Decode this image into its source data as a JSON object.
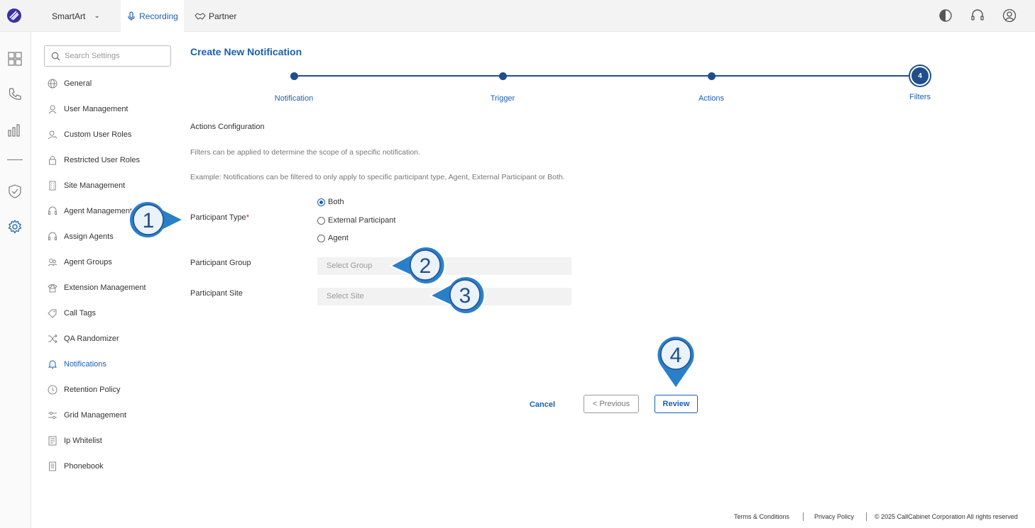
{
  "topbar": {
    "product": "SmartArt",
    "tabs": [
      {
        "label": "Recording",
        "active": true
      },
      {
        "label": "Partner",
        "active": false
      }
    ],
    "accent_color": "#1a5fb4"
  },
  "search": {
    "placeholder": "Search Settings",
    "value": ""
  },
  "sidebar": {
    "items": [
      {
        "label": "General",
        "icon": "globe-icon"
      },
      {
        "label": "User Management",
        "icon": "users-icon"
      },
      {
        "label": "Custom User Roles",
        "icon": "user-key-icon"
      },
      {
        "label": "Restricted User Roles",
        "icon": "lock-icon"
      },
      {
        "label": "Site Management",
        "icon": "building-icon"
      },
      {
        "label": "Agent Management",
        "icon": "headset-icon"
      },
      {
        "label": "Assign Agents",
        "icon": "headset-icon"
      },
      {
        "label": "Agent Groups",
        "icon": "group-icon"
      },
      {
        "label": "Extension Management",
        "icon": "phone-icon"
      },
      {
        "label": "Call Tags",
        "icon": "tag-icon"
      },
      {
        "label": "QA Randomizer",
        "icon": "shuffle-icon"
      },
      {
        "label": "Notifications",
        "icon": "bell-icon",
        "active": true
      },
      {
        "label": "Retention Policy",
        "icon": "clock-icon"
      },
      {
        "label": "Grid Management",
        "icon": "sliders-icon"
      },
      {
        "label": "Ip Whitelist",
        "icon": "list-icon"
      },
      {
        "label": "Phonebook",
        "icon": "book-icon"
      }
    ]
  },
  "page": {
    "title": "Create New Notification",
    "steps": [
      "Notification",
      "Trigger",
      "Actions",
      "Filters"
    ],
    "current_step": "4",
    "section_title": "Actions Configuration",
    "desc1": "Filters can be applied to determine the scope of a specific notification.",
    "desc2": "Example: Notifications can be filtered to only apply to specific participant type, Agent, External Participant or Both."
  },
  "form": {
    "participant_type_label": "Participant Type",
    "required_mark": "*",
    "options": [
      {
        "label": "Both",
        "selected": true
      },
      {
        "label": "External Participant",
        "selected": false
      },
      {
        "label": "Agent",
        "selected": false
      }
    ],
    "participant_group_label": "Participant Group",
    "participant_group_placeholder": "Select Group",
    "participant_site_label": "Participant Site",
    "participant_site_placeholder": "Select Site"
  },
  "buttons": {
    "cancel": "Cancel",
    "previous": "< Previous",
    "review": "Review"
  },
  "callouts": [
    "1",
    "2",
    "3",
    "4"
  ],
  "footer": {
    "terms": "Terms & Conditions",
    "privacy": "Privacy Policy",
    "copyright": "© 2025 CallCabinet Corporation All rights reserved"
  }
}
